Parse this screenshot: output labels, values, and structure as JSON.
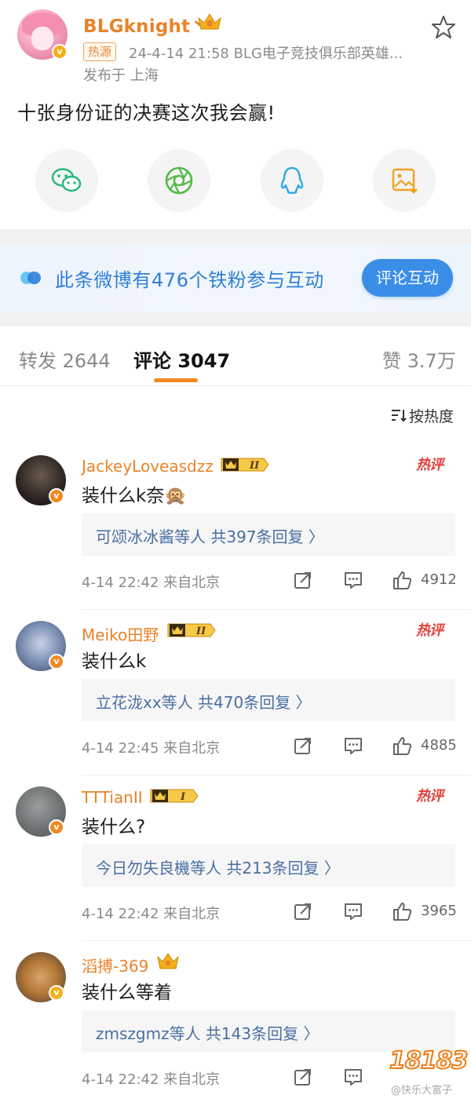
{
  "post": {
    "username": "BLGknight丶",
    "hot_tag": "热源",
    "meta": "24-4-14 21:58  BLG电子竞技俱乐部英雄...",
    "location": "发布于 上海",
    "text": "十张身份证的决赛这次我会赢!",
    "share_icons": [
      "wechat-icon",
      "moments-icon",
      "qq-icon",
      "save-image-icon"
    ],
    "accent": "#e8832a"
  },
  "fan_banner": {
    "text": "此条微博有476个铁粉参与互动",
    "button": "评论互动",
    "accent": "#3b8ee8"
  },
  "tabs": {
    "repost": "转发 2644",
    "comment": "评论 3047",
    "like": "赞 3.7万"
  },
  "sort": {
    "label": "按热度"
  },
  "comments": [
    {
      "name": "JackeyLoveasdzz",
      "level": "II",
      "text": "装什么k奈🙊",
      "hot": "热评",
      "reply": "可颂冰冰酱等人  共397条回复 〉",
      "time": "4-14 22:42  来自北京",
      "likes": "4912"
    },
    {
      "name": "Meiko田野",
      "level": "II",
      "text": "装什么k",
      "hot": "热评",
      "reply": "立花泷xx等人  共470条回复 〉",
      "time": "4-14 22:45  来自北京",
      "likes": "4885"
    },
    {
      "name": "TTTianII",
      "level": "I",
      "text": "装什么?",
      "hot": "热评",
      "reply": "今日勿失良機等人  共213条回复 〉",
      "time": "4-14 22:42  来自北京",
      "likes": "3965"
    },
    {
      "name": "滔搏-369",
      "level": "",
      "text": "装什么等着",
      "hot": "",
      "reply": "zmszgmz等人  共143条回复 〉",
      "time": "4-14 22:42  来自北京",
      "likes": ""
    }
  ],
  "watermark": {
    "logo": "18183",
    "text": "@快乐大富子"
  }
}
